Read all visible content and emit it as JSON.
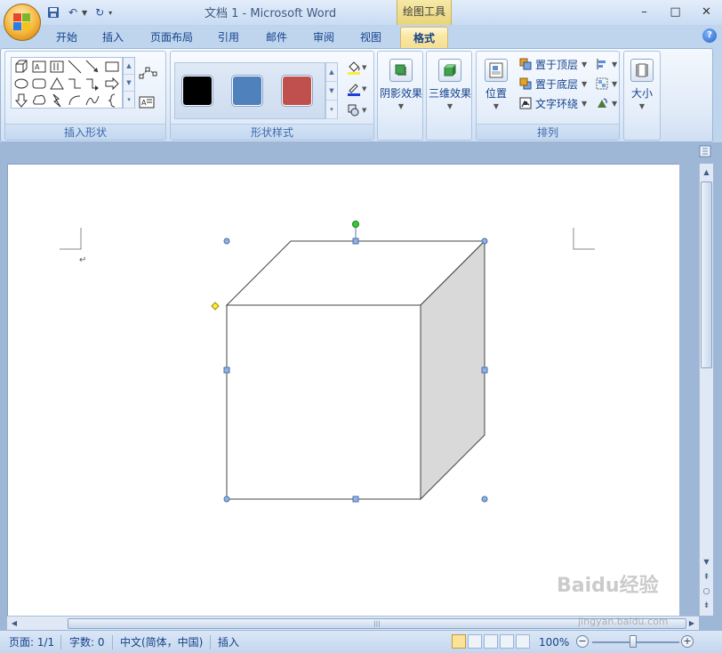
{
  "window": {
    "title": "文档 1 - Microsoft Word",
    "contextual_tab_header": "绘图工具",
    "controls": [
      "–",
      "□",
      "✕"
    ]
  },
  "tabs": [
    {
      "label": "开始",
      "active": false
    },
    {
      "label": "插入",
      "active": false
    },
    {
      "label": "页面布局",
      "active": false
    },
    {
      "label": "引用",
      "active": false
    },
    {
      "label": "邮件",
      "active": false
    },
    {
      "label": "审阅",
      "active": false
    },
    {
      "label": "视图",
      "active": false
    },
    {
      "label": "格式",
      "active": true
    }
  ],
  "help_symbol": "?",
  "ribbon": {
    "insert_shapes": {
      "label": "插入形状"
    },
    "shape_styles": {
      "label": "形状样式",
      "swatches": [
        "#000000",
        "#4f81bd",
        "#c0504d"
      ]
    },
    "shadow_effects": {
      "label": "阴影效果"
    },
    "threed_effects": {
      "label": "三维效果"
    },
    "arrange": {
      "label": "排列",
      "position": "位置",
      "bring_to_front": "置于顶层",
      "send_to_back": "置于底层",
      "text_wrap": "文字环绕"
    },
    "size": {
      "label": "大小"
    }
  },
  "document": {
    "paragraph_mark": "↵"
  },
  "status": {
    "page": "页面: 1/1",
    "word_count": "字数: 0",
    "language": "中文(简体，中国)",
    "mode": "插入",
    "zoom": "100%"
  },
  "watermark": {
    "text": "Baidu经验",
    "sub": "jingyan.baidu.com"
  }
}
